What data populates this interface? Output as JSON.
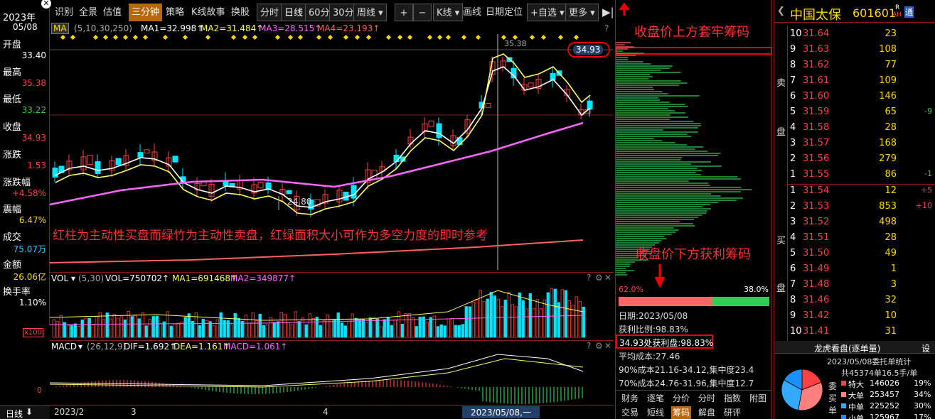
{
  "header": {
    "year": "2023年",
    "date": "05/08"
  },
  "left_panel": {
    "items": [
      {
        "label": "开盘",
        "value": "33.40",
        "color": "#ffffff"
      },
      {
        "label": "最高",
        "value": "35.38",
        "color": "#ff4040"
      },
      {
        "label": "最低",
        "value": "33.22",
        "color": "#33cc33"
      },
      {
        "label": "收盘",
        "value": "34.93",
        "color": "#ff4040"
      },
      {
        "label": "涨跌",
        "value": "1.53",
        "color": "#ff4040"
      },
      {
        "label": "涨跌幅",
        "value": "+4.58%",
        "color": "#ff4040"
      },
      {
        "label": "震幅",
        "value": "6.47%",
        "color": "#ffd700"
      },
      {
        "label": "成交",
        "value": "75.07万",
        "color": "#33ccff"
      },
      {
        "label": "金额",
        "value": "26.06亿",
        "color": "#ffd700"
      },
      {
        "label": "换手率",
        "value": "1.10%",
        "color": "#ffffff"
      }
    ],
    "bottom_tab": "日线"
  },
  "toolbar": {
    "items": [
      "识别",
      "全景",
      "估值",
      "三分钟",
      "策略",
      "K线故事",
      "换股"
    ],
    "periods": [
      "分时",
      "日线",
      "60分",
      "30分",
      "周线 ▾"
    ],
    "active_item": "三分钟",
    "active_period": "日线",
    "zoom_plus": "+",
    "zoom_minus": "−",
    "right_items": [
      "K线 ▾",
      "画线",
      "日期定位",
      "+自选 ▾",
      "更多 ▾"
    ]
  },
  "ma_bar": {
    "label": "MA",
    "params": "(5,10,30,250)",
    "ma1": "MA1=32.998↑",
    "ma2": "MA2=31.484↑",
    "ma3": "MA3=28.515↑",
    "ma4": "MA4=23.193↑",
    "help": "?"
  },
  "chart_annotations": {
    "high_label": "35.38",
    "low_label": "24.80",
    "close_bubble": "34.93",
    "price_ticks": [
      "33.40"
    ],
    "overlay_text": "红柱为主动性买盘而绿竹为主动性卖盘，红绿面积大小可作为多空力度的即时参考",
    "overlay_color": "#ff3030"
  },
  "vol_bar": {
    "label": "VOL",
    "params": "(5,30)",
    "vol": "VOL=750702↑",
    "ma1": "MA1=691468↑",
    "ma2": "MA2=349877↑",
    "unit": "x100"
  },
  "macd_bar": {
    "label": "MACD",
    "params": "(26,12,9)",
    "dif": "DIF=1.692↑",
    "dea": "DEA=1.161↑",
    "macd": "MACD=1.061↑",
    "zero": "0"
  },
  "x_axis": {
    "labels": [
      "2023/2",
      "3",
      "4"
    ],
    "cursor_date": "2023/05/08,一"
  },
  "chips_panel": {
    "top_annotation": "收盘价上方套牢筹码",
    "bottom_annotation": "收盘价下方获利筹码",
    "left_pct": "62.0%",
    "right_pct": "38.0%",
    "date": "日期:2023/05/08",
    "profit_ratio": "获利比例:98.83%",
    "at_price": "34.93处获利盘:98.83%",
    "avg_cost": "平均成本:27.46",
    "cost90": "90%成本21.16-34.12,集中度23.4",
    "cost70": "70%成本24.76-31.96,集中度12.7",
    "tabs_row1": [
      "财务",
      "逐笔",
      "分价",
      "分时",
      "指数",
      "附图"
    ],
    "tabs_row2": [
      "交易",
      "短线",
      "筹码",
      "解盘",
      "研评"
    ],
    "active_tab": "筹码"
  },
  "orderbook": {
    "stock_name": "中国太保",
    "stock_code": "601601",
    "badge_top": "R",
    "badge_bottom": "AH",
    "badge_side": "通",
    "sell_label": "卖",
    "sell_label2": "盘",
    "buy_label": "买",
    "buy_label2": "盘",
    "sell": [
      {
        "n": "10",
        "price": "31.64",
        "vol": "23",
        "chg": ""
      },
      {
        "n": "9",
        "price": "31.63",
        "vol": "108",
        "chg": ""
      },
      {
        "n": "8",
        "price": "31.62",
        "vol": "77",
        "chg": ""
      },
      {
        "n": "7",
        "price": "31.61",
        "vol": "109",
        "chg": ""
      },
      {
        "n": "6",
        "price": "31.60",
        "vol": "146",
        "chg": ""
      },
      {
        "n": "5",
        "price": "31.59",
        "vol": "65",
        "chg": "-9"
      },
      {
        "n": "4",
        "price": "31.58",
        "vol": "28",
        "chg": ""
      },
      {
        "n": "3",
        "price": "31.57",
        "vol": "168",
        "chg": ""
      },
      {
        "n": "2",
        "price": "31.56",
        "vol": "279",
        "chg": ""
      },
      {
        "n": "1",
        "price": "31.55",
        "vol": "86",
        "chg": "-1"
      }
    ],
    "buy": [
      {
        "n": "1",
        "price": "31.54",
        "vol": "12",
        "chg": "+5"
      },
      {
        "n": "2",
        "price": "31.53",
        "vol": "853",
        "chg": "+10"
      },
      {
        "n": "3",
        "price": "31.52",
        "vol": "498",
        "chg": ""
      },
      {
        "n": "4",
        "price": "31.51",
        "vol": "28",
        "chg": ""
      },
      {
        "n": "5",
        "price": "31.50",
        "vol": "49",
        "chg": ""
      },
      {
        "n": "6",
        "price": "31.49",
        "vol": "1",
        "chg": ""
      },
      {
        "n": "7",
        "price": "31.48",
        "vol": "3",
        "chg": ""
      },
      {
        "n": "8",
        "price": "31.46",
        "vol": "32",
        "chg": ""
      },
      {
        "n": "9",
        "price": "31.42",
        "vol": "10",
        "chg": ""
      },
      {
        "n": "10",
        "price": "31.41",
        "vol": "31",
        "chg": ""
      }
    ]
  },
  "dragon": {
    "title": "龙虎看盘(逐单量)",
    "settings": "设",
    "subtitle": "2023/05/08委托单统计",
    "total": "共45374单16.5手/单",
    "side_label": [
      "委",
      "买",
      "单"
    ],
    "rows": [
      {
        "label": "特大",
        "vol": "146026",
        "pct": "19%"
      },
      {
        "label": "大单",
        "vol": "253457",
        "pct": "34%"
      },
      {
        "label": "中单",
        "vol": "225252",
        "pct": "30%"
      },
      {
        "label": "小单",
        "vol": "125967",
        "pct": "17%"
      }
    ]
  },
  "colors": {
    "up": "#ff4040",
    "down": "#00e5ff",
    "ma1": "#ffffff",
    "ma2": "#ffff66",
    "ma3": "#ff66ff",
    "ma4": "#ff6060",
    "border": "#8a1d1d",
    "accent": "#b8670c"
  }
}
